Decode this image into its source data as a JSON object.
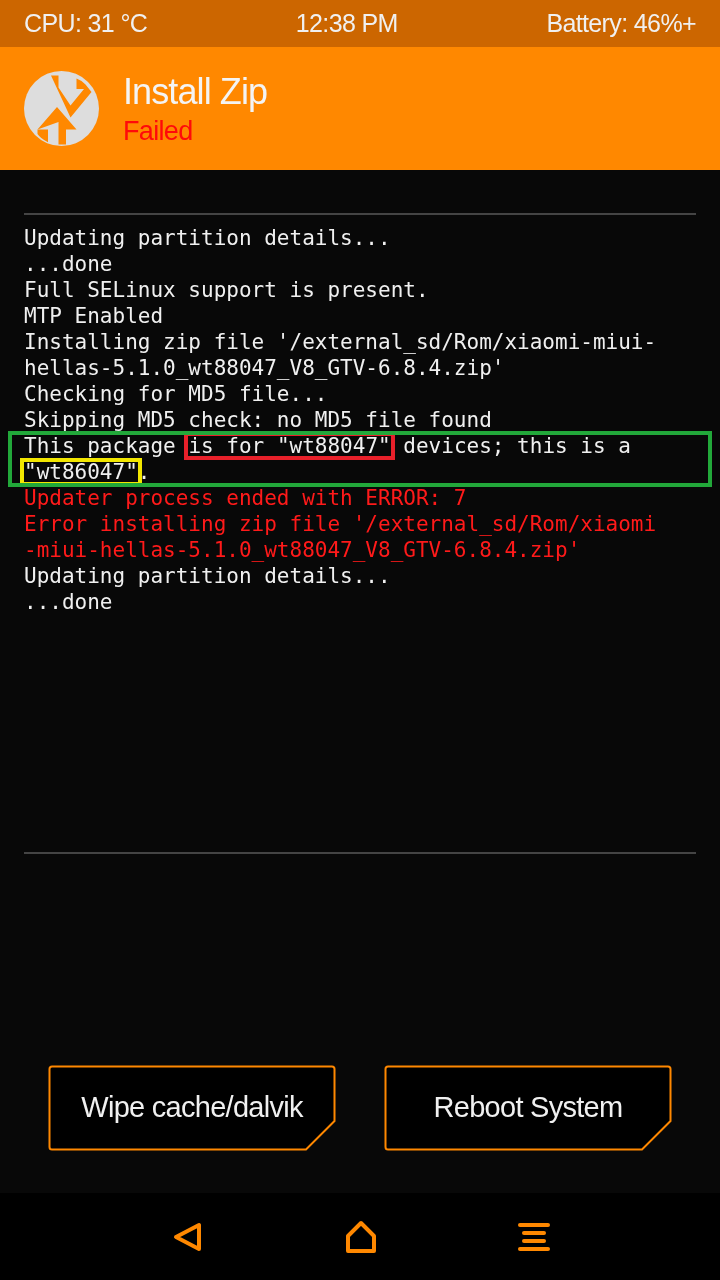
{
  "status_bar": {
    "cpu": "CPU: 31 °C",
    "time": "12:38 PM",
    "battery": "Battery: 46%+"
  },
  "header": {
    "title": "Install Zip",
    "status": "Failed",
    "failed": true
  },
  "log": [
    {
      "kind": "line",
      "error": false,
      "segments": [
        {
          "text": "Updating partition details..."
        }
      ]
    },
    {
      "kind": "line",
      "error": false,
      "segments": [
        {
          "text": "...done"
        }
      ]
    },
    {
      "kind": "line",
      "error": false,
      "segments": [
        {
          "text": "Full SELinux support is present."
        }
      ]
    },
    {
      "kind": "line",
      "error": false,
      "segments": [
        {
          "text": "MTP Enabled"
        }
      ]
    },
    {
      "kind": "line",
      "error": false,
      "segments": [
        {
          "text": "Installing zip file '/external_sd/Rom/xiaomi-miui-"
        }
      ]
    },
    {
      "kind": "line",
      "error": false,
      "segments": [
        {
          "text": "hellas-5.1.0_wt88047_V8_GTV-6.8.4.zip'"
        }
      ]
    },
    {
      "kind": "line",
      "error": false,
      "segments": [
        {
          "text": "Checking for MD5 file..."
        }
      ]
    },
    {
      "kind": "line",
      "error": false,
      "segments": [
        {
          "text": "Skipping MD5 check: no MD5 file found"
        }
      ]
    },
    {
      "kind": "group",
      "color": "#22a83a",
      "lines": [
        {
          "error": false,
          "segments": [
            {
              "text": "This package "
            },
            {
              "text": "is for \"wt88047\"",
              "color": "#e8202a"
            },
            {
              "text": " devices; this is a"
            }
          ]
        },
        {
          "error": false,
          "segments": [
            {
              "text": "\"wt86047\"",
              "color": "#f2e600"
            },
            {
              "text": "."
            }
          ]
        }
      ]
    },
    {
      "kind": "line",
      "error": true,
      "segments": [
        {
          "text": "Updater process ended with ERROR: 7"
        }
      ]
    },
    {
      "kind": "line",
      "error": true,
      "segments": [
        {
          "text": "Error installing zip file '/external_sd/Rom/xiaomi"
        }
      ]
    },
    {
      "kind": "line",
      "error": true,
      "segments": [
        {
          "text": "-miui-hellas-5.1.0_wt88047_V8_GTV-6.8.4.zip'"
        }
      ]
    },
    {
      "kind": "line",
      "error": false,
      "segments": [
        {
          "text": "Updating partition details..."
        }
      ]
    },
    {
      "kind": "line",
      "error": false,
      "segments": [
        {
          "text": "...done"
        }
      ]
    }
  ],
  "buttons": [
    {
      "label": "Wipe cache/dalvik"
    },
    {
      "label": "Reboot System"
    }
  ]
}
